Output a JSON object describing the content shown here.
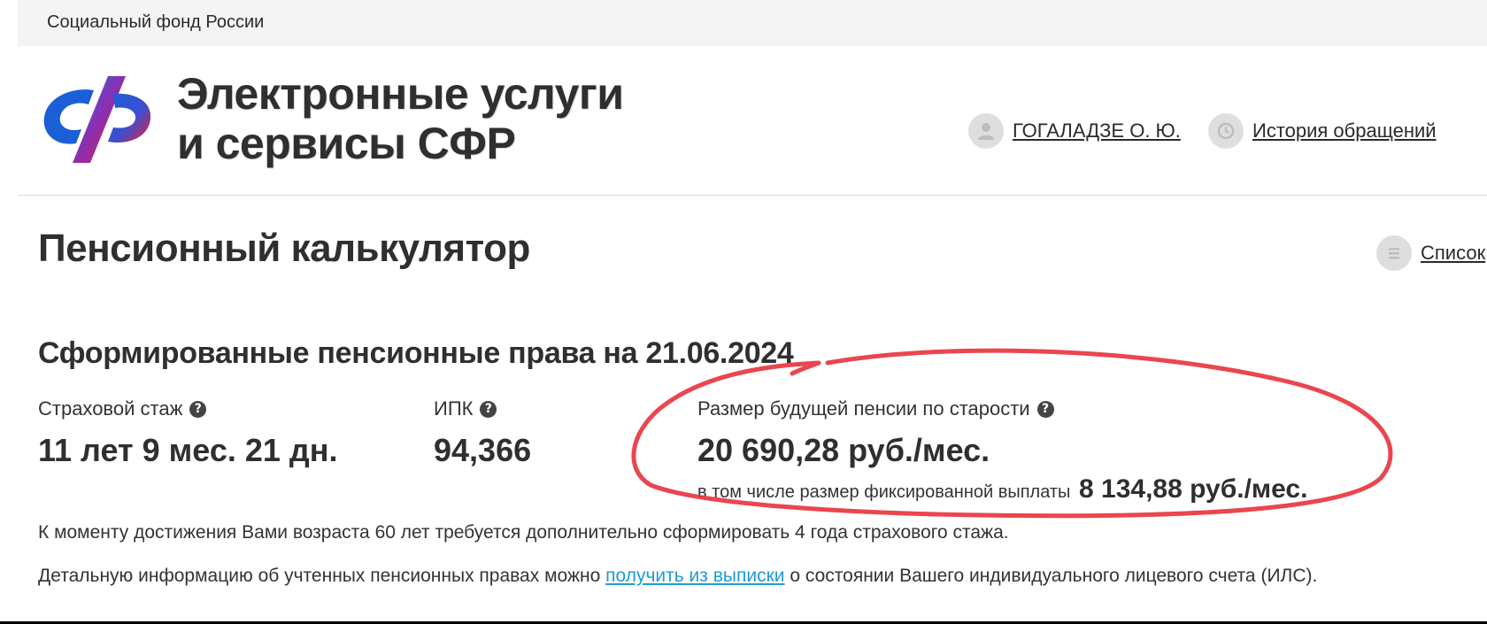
{
  "topbar": {
    "org_name": "Социальный фонд России"
  },
  "header": {
    "brand_line1": "Электронные услуги",
    "brand_line2": "и сервисы СФР",
    "user_name": "ГОГАЛАДЗЕ О. Ю.",
    "history_label": "История обращений"
  },
  "main": {
    "page_title": "Пенсионный калькулятор",
    "list_label": "Список",
    "section_title": "Сформированные пенсионные права на 21.06.2024",
    "stats": {
      "insurance_label": "Страховой стаж",
      "insurance_value": "11 лет 9 мес. 21 дн.",
      "ipk_label": "ИПК",
      "ipk_value": "94,366",
      "pension_label": "Размер будущей пенсии по старости",
      "pension_value": "20 690,28 руб./мес.",
      "fixed_prefix": "в том числе размер фиксированной выплаты",
      "fixed_value": "8 134,88 руб./мес."
    },
    "info1": "К моменту достижения Вами возраста 60 лет требуется дополнительно сформировать 4 года страхового стажа.",
    "info2_prefix": "Детальную информацию об учтенных пенсионных правах можно",
    "info2_link": "получить из выписки",
    "info2_suffix": "о состоянии Вашего индивидуального лицевого счета (ИЛС)."
  },
  "colors": {
    "link": "#1f9ad6",
    "highlight": "#e8323c",
    "logo_blue": "#1a5fd6",
    "logo_red": "#e41e3f"
  },
  "icons": {
    "help": "question-circle-icon",
    "user": "user-icon",
    "history": "history-icon",
    "list": "list-icon"
  }
}
